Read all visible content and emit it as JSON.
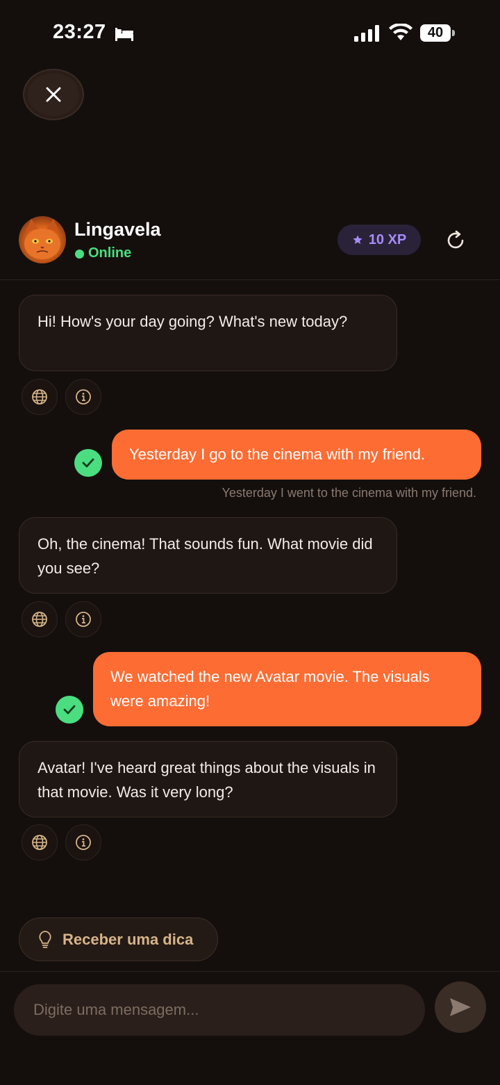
{
  "status_bar": {
    "time": "23:27",
    "battery": "40"
  },
  "header": {
    "contact_name": "Lingavela",
    "status": "Online",
    "xp_badge": "10 XP"
  },
  "messages": [
    {
      "sender": "bot",
      "text": "Hi! How's your day going? What's new today?"
    },
    {
      "sender": "user",
      "text": "Yesterday I go to the cinema with my friend.",
      "correction": "Yesterday I went to the cinema with my friend."
    },
    {
      "sender": "bot",
      "text": "Oh, the cinema! That sounds fun. What movie did you see?"
    },
    {
      "sender": "user",
      "text": "We watched the new Avatar movie. The visuals were amazing!"
    },
    {
      "sender": "bot",
      "text": "Avatar! I've heard great things about the visuals in that movie. Was it very long?"
    }
  ],
  "hint_button": {
    "label": "Receber uma dica"
  },
  "composer": {
    "placeholder": "Digite uma mensagem..."
  },
  "colors": {
    "accent": "#fd6c33",
    "online": "#4ade80",
    "xp": "#a78bfa",
    "background": "#140f0d"
  },
  "icons": [
    "bed-icon",
    "signal-icon",
    "wifi-icon",
    "close-icon",
    "star-icon",
    "refresh-icon",
    "globe-icon",
    "info-icon",
    "check-icon",
    "lightbulb-icon",
    "send-icon"
  ]
}
